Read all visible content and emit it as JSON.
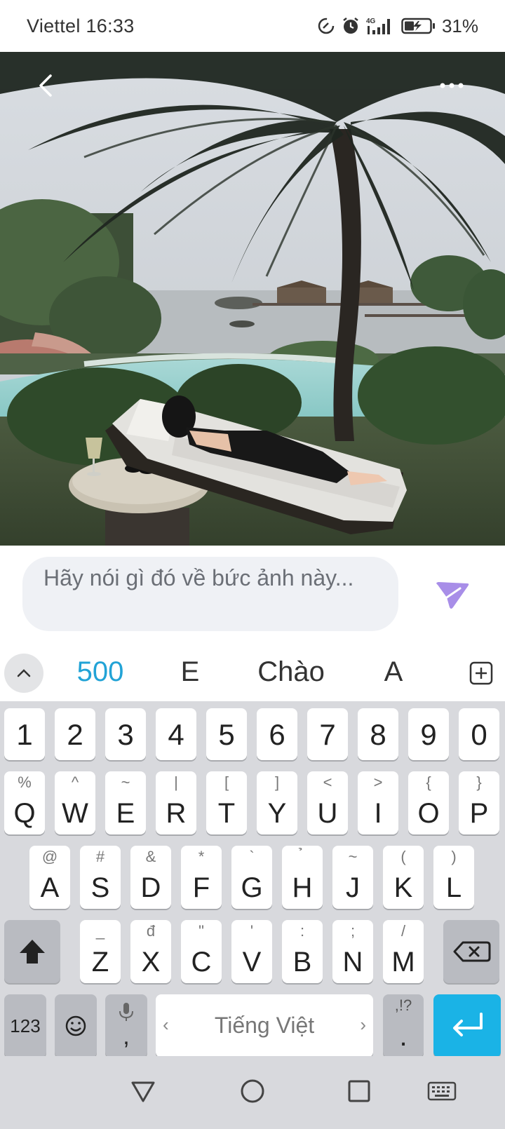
{
  "status_bar": {
    "carrier": "Viettel",
    "time": "16:33",
    "network": "4G",
    "battery": "31%"
  },
  "photo": {
    "icons": {
      "back": "chevron-left-icon",
      "more": "more-horizontal-icon"
    }
  },
  "composer": {
    "placeholder": "Hãy nói gì đó về bức ảnh này...",
    "send_icon": "send-icon",
    "accent": "#a88ee8"
  },
  "suggestions": {
    "items": [
      "500",
      "E",
      "Chào",
      "A"
    ],
    "highlight_color": "#22a3d6"
  },
  "keyboard": {
    "number_row": [
      "1",
      "2",
      "3",
      "4",
      "5",
      "6",
      "7",
      "8",
      "9",
      "0"
    ],
    "row1": [
      {
        "main": "Q",
        "alt": "%"
      },
      {
        "main": "W",
        "alt": "^"
      },
      {
        "main": "E",
        "alt": "~"
      },
      {
        "main": "R",
        "alt": "|"
      },
      {
        "main": "T",
        "alt": "["
      },
      {
        "main": "Y",
        "alt": "]"
      },
      {
        "main": "U",
        "alt": "<"
      },
      {
        "main": "I",
        "alt": ">"
      },
      {
        "main": "O",
        "alt": "{"
      },
      {
        "main": "P",
        "alt": "}"
      }
    ],
    "row2": [
      {
        "main": "A",
        "alt": "@"
      },
      {
        "main": "S",
        "alt": "#"
      },
      {
        "main": "D",
        "alt": "&"
      },
      {
        "main": "F",
        "alt": "*"
      },
      {
        "main": "G",
        "alt": "`"
      },
      {
        "main": "H",
        "alt": "̉"
      },
      {
        "main": "J",
        "alt": "~"
      },
      {
        "main": "K",
        "alt": "("
      },
      {
        "main": "L",
        "alt": ")"
      }
    ],
    "row3": [
      {
        "main": "Z",
        "alt": "_"
      },
      {
        "main": "X",
        "alt": "đ"
      },
      {
        "main": "C",
        "alt": "\""
      },
      {
        "main": "V",
        "alt": "'"
      },
      {
        "main": "B",
        "alt": ":"
      },
      {
        "main": "N",
        "alt": ";"
      },
      {
        "main": "M",
        "alt": "/"
      }
    ],
    "numbers_key": "123",
    "comma_key": ",",
    "space_label": "Tiếng Việt",
    "period_key": ".",
    "period_alt": ",!?",
    "enter_color": "#1ab3e6"
  }
}
